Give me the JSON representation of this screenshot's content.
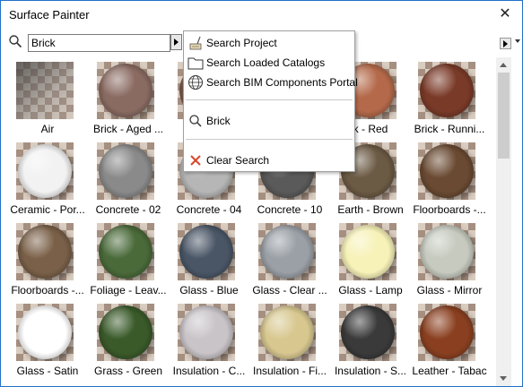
{
  "window": {
    "title": "Surface Painter"
  },
  "search": {
    "value": "Brick",
    "placeholder": ""
  },
  "menu": {
    "items": [
      {
        "label": "Search Project",
        "icon": "brush-icon"
      },
      {
        "label": "Search Loaded Catalogs",
        "icon": "folder-icon"
      },
      {
        "label": "Search BIM Components Portal",
        "icon": "globe-icon"
      },
      {
        "label": "Brick",
        "icon": "search-icon"
      },
      {
        "label": "Clear Search",
        "icon": "clear-x-icon"
      }
    ]
  },
  "surfaces": [
    {
      "label": "Air",
      "color": "#5a5a5a",
      "style": "box"
    },
    {
      "label": "Brick - Aged ...",
      "color": "#8a6b62"
    },
    {
      "label": "Br",
      "color": "#7a5a50"
    },
    {
      "label": "",
      "color": "#8b4a3a"
    },
    {
      "label": "k - Red",
      "color": "#b46a4a"
    },
    {
      "label": "Brick - Runni...",
      "color": "#7a3a28"
    },
    {
      "label": "Ceramic - Por...",
      "color": "#f2f2f2"
    },
    {
      "label": "Concrete - 02",
      "color": "#8a8a8a"
    },
    {
      "label": "Concrete - 04",
      "color": "#b6b6b6"
    },
    {
      "label": "Concrete - 10",
      "color": "#5a5a5a"
    },
    {
      "label": "Earth - Brown",
      "color": "#6b5a44"
    },
    {
      "label": "Floorboards -...",
      "color": "#6a4a32"
    },
    {
      "label": "Floorboards -...",
      "color": "#7a6048"
    },
    {
      "label": "Foliage - Leav...",
      "color": "#4a6a3a"
    },
    {
      "label": "Glass - Blue",
      "color": "#4a5666"
    },
    {
      "label": "Glass - Clear ...",
      "color": "#9aa0a6"
    },
    {
      "label": "Glass - Lamp",
      "color": "#f7f2b8"
    },
    {
      "label": "Glass - Mirror",
      "color": "#c6cabf"
    },
    {
      "label": "Glass - Satin",
      "color": "#ffffff"
    },
    {
      "label": "Grass - Green",
      "color": "#3a5a2a"
    },
    {
      "label": "Insulation - C...",
      "color": "#c9c4c8"
    },
    {
      "label": "Insulation - Fi...",
      "color": "#d8c890"
    },
    {
      "label": "Insulation - S...",
      "color": "#3a3a3a"
    },
    {
      "label": "Leather - Tabac",
      "color": "#8a4020"
    }
  ]
}
